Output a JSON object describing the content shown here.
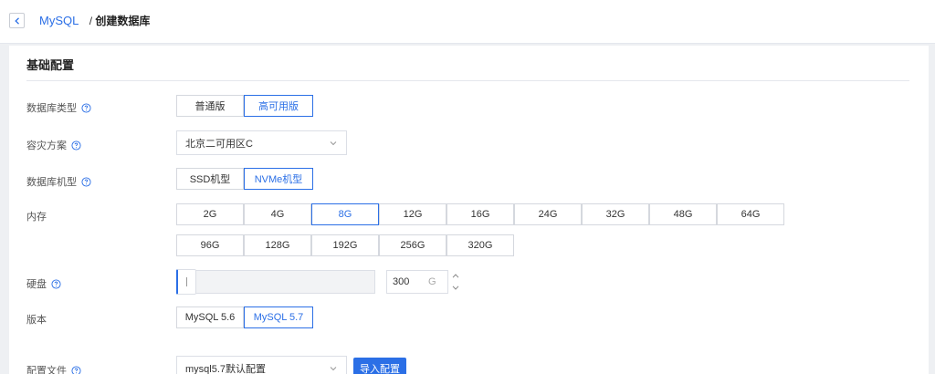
{
  "header": {
    "breadcrumb_parent": "MySQL",
    "breadcrumb_separator": "/",
    "breadcrumb_current": "创建数据库"
  },
  "section": {
    "title": "基础配置"
  },
  "db_type": {
    "label": "数据库类型",
    "options": [
      "普通版",
      "高可用版"
    ],
    "selected": "高可用版"
  },
  "disaster_plan": {
    "label": "容灾方案",
    "value": "北京二可用区C"
  },
  "machine_type": {
    "label": "数据库机型",
    "options": [
      "SSD机型",
      "NVMe机型"
    ],
    "selected": "NVMe机型"
  },
  "memory": {
    "label": "内存",
    "row1": [
      "2G",
      "4G",
      "8G",
      "12G",
      "16G",
      "24G",
      "32G",
      "48G",
      "64G"
    ],
    "row2": [
      "96G",
      "128G",
      "192G",
      "256G",
      "320G"
    ],
    "selected": "8G"
  },
  "disk": {
    "label": "硬盘",
    "value": "300",
    "unit": "G",
    "slider_fraction": 0.0
  },
  "version": {
    "label": "版本",
    "options": [
      "MySQL 5.6",
      "MySQL 5.7"
    ],
    "selected": "MySQL 5.7"
  },
  "config_file": {
    "label": "配置文件",
    "value": "mysql5.7默认配置",
    "import_button": "导入配置"
  },
  "colors": {
    "accent": "#2b6fe6",
    "border": "#d5d8de"
  },
  "icons": {
    "back": "chevron-left-icon",
    "help": "question-circle-icon",
    "dropdown": "chevron-down-icon"
  }
}
